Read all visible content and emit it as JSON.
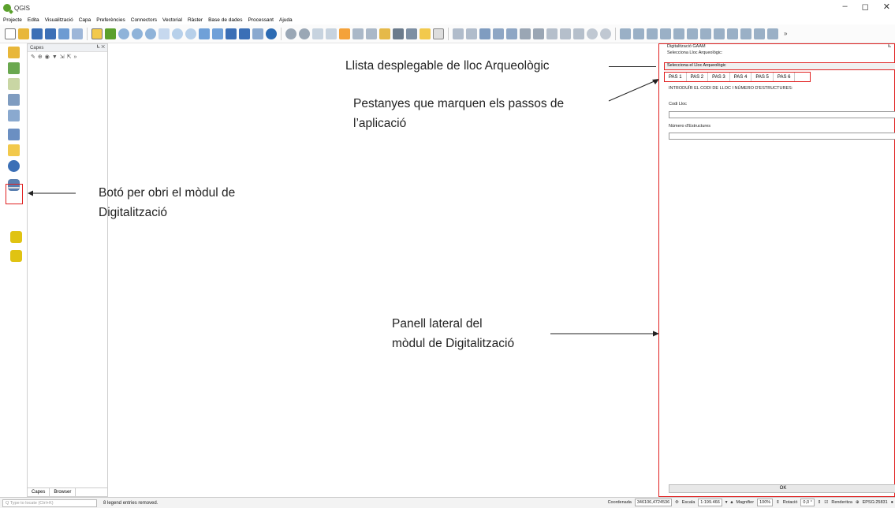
{
  "app": {
    "name": "QGIS",
    "win_controls": [
      "–",
      "◻",
      "✕"
    ]
  },
  "menu": [
    "Projecte",
    "Edita",
    "Visualització",
    "Capa",
    "Preferències",
    "Connectors",
    "Vectorial",
    "Ràster",
    "Base de dades",
    "Processant",
    "Ajuda"
  ],
  "colors": {
    "highlight": "#e02020",
    "qgis_green": "#5aa02c"
  },
  "layers_panel": {
    "title": "Capes",
    "tabs": [
      "Capes",
      "Browser"
    ]
  },
  "annotations": {
    "combo": "Llista desplegable de lloc Arqueològic",
    "tabs_line1": "Pestanyes que marquen els passos de",
    "tabs_line2": "l’aplicació",
    "button_line1": "Botó per obri el mòdul de",
    "button_line2": "Digitalització",
    "panel_line1": "Panell lateral del",
    "panel_line2": "mòdul de Digitalització"
  },
  "digit_panel": {
    "title": "Digitalització GAAM",
    "select_label": "Selecciona Lloc Arqueològic:",
    "combo_value": "Selecciona el Lloc Arqueològic",
    "tabs": [
      "PAS 1",
      "PAS 2",
      "PAS 3",
      "PAS 4",
      "PAS 5",
      "PAS 6"
    ],
    "instructions": "INTRODUÏR EL CODI DE LLOC I NÚMERO D'ESTRUCTURES:",
    "field1_label": "Codi Lloc",
    "field2_label": "Número d'Estructures",
    "ok_label": "OK"
  },
  "statusbar": {
    "locate_placeholder": "Q  Type to locate (Ctrl+K)",
    "message": "8 legend entries removed.",
    "coord_label": "Coordenada",
    "coord_value": "346106,4724536",
    "scale_label": "Escala",
    "scale_value": "1:199.466",
    "magnifier_label": "Magnifier",
    "magnifier_value": "100%",
    "rotation_label": "Rotació",
    "rotation_value": "0,0 °",
    "render_label": "Renderitza",
    "crs_label": "EPSG:25831"
  }
}
